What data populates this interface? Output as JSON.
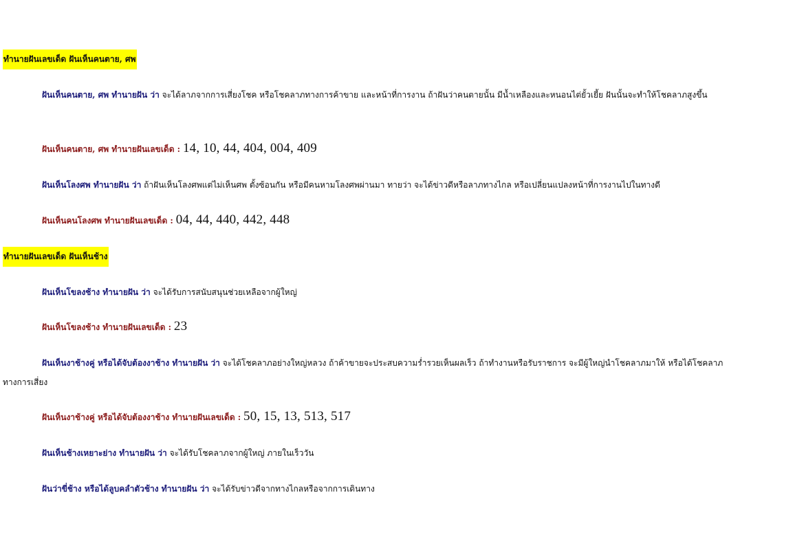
{
  "sections": [
    {
      "heading": "ทำนายฝันเลขเด็ด ฝันเห็นคนตาย, ศพ",
      "items": [
        {
          "label": "ฝันเห็นคนตาย, ศพ ทำนายฝัน ว่า",
          "text": "จะได้ลาภจากการเสี่ยงโชค หรือโชคลาภทางการค้าขาย และหน้าที่การงาน ถ้าฝันว่าคนตายนั้น มีน้ำเหลืองและหนอนไต่ยั้วเยี้ย ฝันนั้นจะทำให้โชคลาภสูงขึ้น"
        },
        {
          "label": "ฝันเห็นคนตาย, ศพ ทำนายฝันเลขเด็ด :",
          "numbers": "14, 10, 44, 404, 004, 409"
        },
        {
          "label": "ฝันเห็นโลงศพ ทำนายฝัน ว่า",
          "text": "ถ้าฝันเห็นโลงศพแต่ไม่เห็นศพ ตั้งซ้อนกัน หรือมีคนหามโลงศพผ่านมา ทายว่า จะได้ข่าวดีหรือลาภทางไกล หรือเปลี่ยนแปลงหน้าที่การงานไปในทางดี"
        },
        {
          "label": "ฝันเห็นคนโลงศพ ทำนายฝันเลขเด็ด :",
          "numbers": "04, 44, 440, 442, 448"
        }
      ]
    },
    {
      "heading": "ทำนายฝันเลขเด็ด ฝันเห็นช้าง",
      "items": [
        {
          "label": "ฝันเห็นโขลงช้าง ทำนายฝัน ว่า",
          "text": "จะได้รับการสนับสนุนช่วยเหลือจากผู้ใหญ่"
        },
        {
          "label": "ฝันเห็นโขลงช้าง ทำนายฝันเลขเด็ด :",
          "numbers": "23"
        },
        {
          "label": "ฝันเห็นงาช้างคู่ หรือได้จับต้องงาช้าง ทำนายฝัน ว่า",
          "text": "จะได้โชคลาภอย่างใหญ่หลวง ถ้าค้าขายจะประสบความร่ำรวยเห็นผลเร็ว ถ้าทำงานหรือรับราชการ จะมีผู้ใหญ่นำโชคลาภมาให้ หรือได้โชคลาภทางการเสี่ยง"
        },
        {
          "label": "ฝันเห็นงาช้างคู่ หรือได้จับต้องงาช้าง ทำนายฝันเลขเด็ด :",
          "numbers": "50, 15, 13, 513, 517"
        },
        {
          "label": "ฝันเห็นช้างเหยาะย่าง ทำนายฝัน ว่า",
          "text": "จะได้รับโชคลาภจากผู้ใหญ่ ภายในเร็ววัน"
        },
        {
          "label": "ฝันว่าขี่ช้าง หรือได้ลูบคลำตัวช้าง ทำนายฝัน ว่า",
          "text": "จะได้รับข่าวดีจากทางไกลหรือจากการเดินทาง"
        }
      ]
    }
  ],
  "colors": {
    "heading_highlight": "#ffff00",
    "label_navy": "#1c1c7a",
    "label_red": "#8b1a1a",
    "text": "#111111"
  }
}
